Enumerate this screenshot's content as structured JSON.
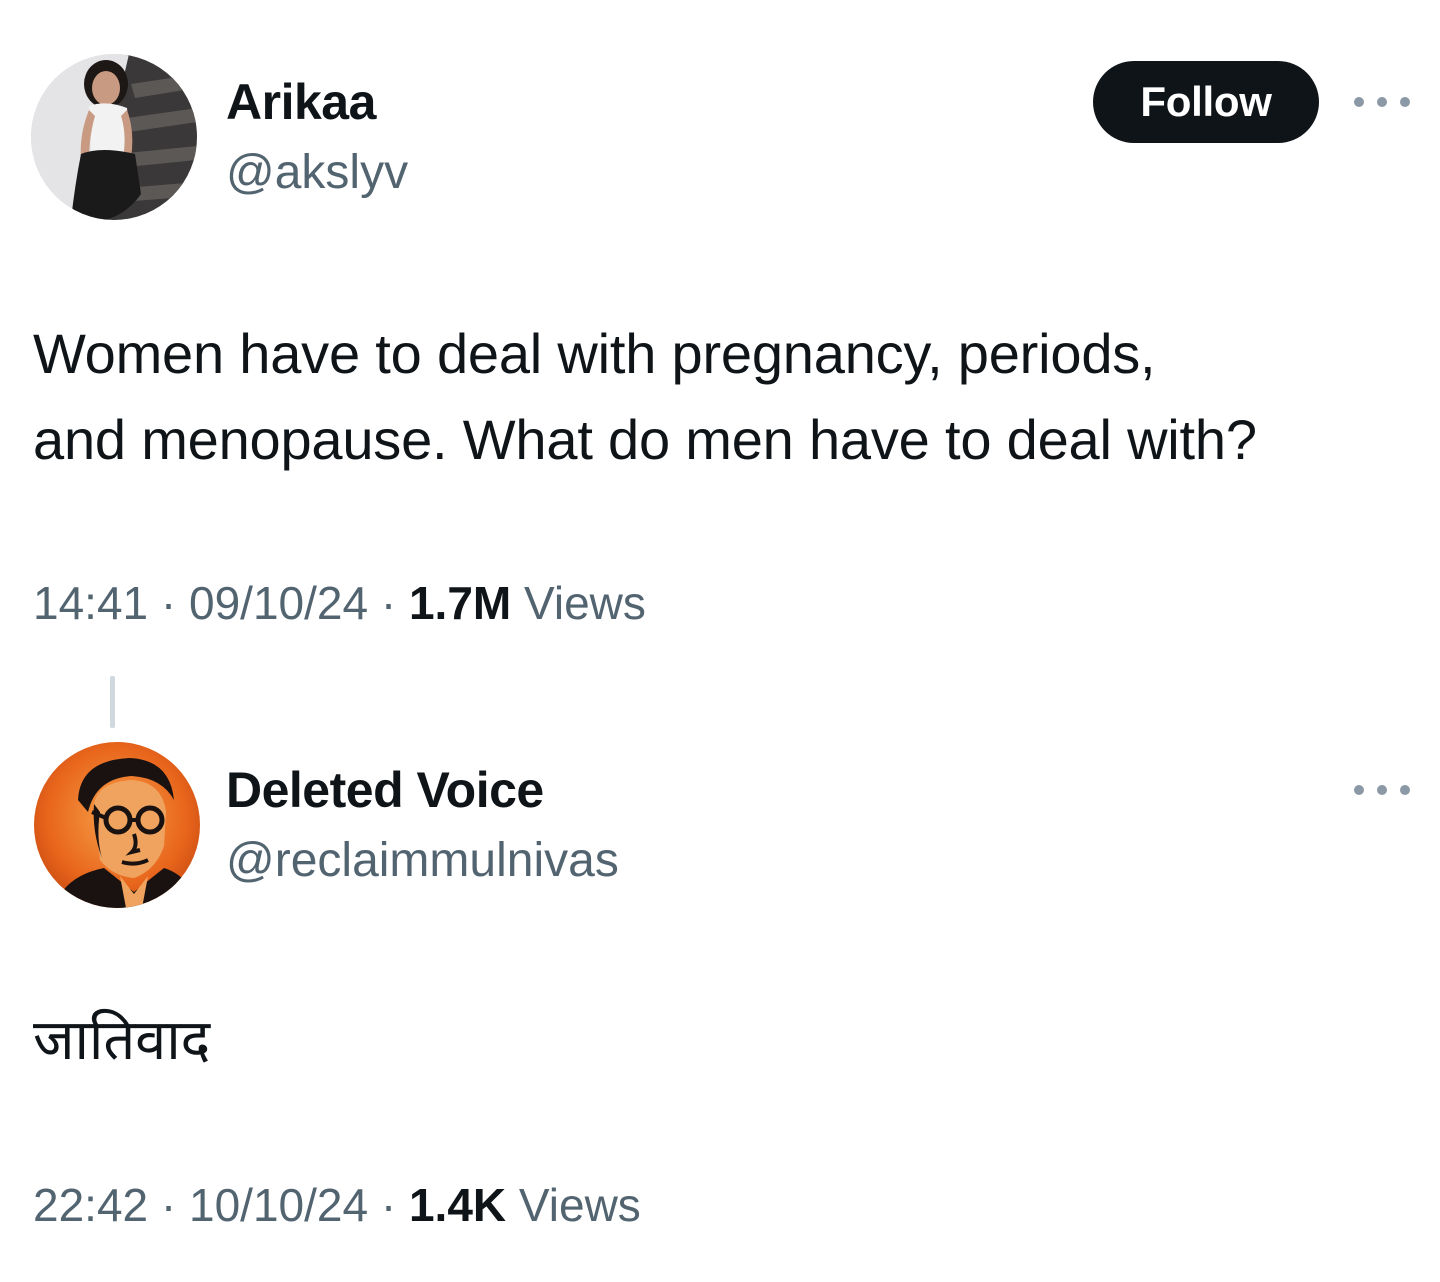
{
  "tweets": [
    {
      "display_name": "Arikaa",
      "handle": "@akslyv",
      "text_line1": "Women have to deal with pregnancy, periods,",
      "text_line2": "and menopause. What do men have to deal with?",
      "time": "14:41",
      "date": "09/10/24",
      "views_count": "1.7M",
      "views_label": "Views",
      "separator": "·",
      "avatar_icon": "profile-photo-woman-on-stairs"
    },
    {
      "display_name": "Deleted Voice",
      "handle": "@reclaimmulnivas",
      "text_line1": "जातिवाद",
      "time": "22:42",
      "date": "10/10/24",
      "views_count": "1.4K",
      "views_label": "Views",
      "separator": "·",
      "avatar_icon": "profile-portrait-man-orange-background"
    }
  ],
  "follow_button": {
    "label": "Follow"
  },
  "more_icon": "more-options-icon",
  "colors": {
    "text_primary": "#0f1419",
    "text_secondary": "#536471",
    "follow_bg": "#0f1419",
    "follow_text": "#ffffff",
    "thread_line": "#cfd9de",
    "avatar2_bg": "#e8651c"
  }
}
